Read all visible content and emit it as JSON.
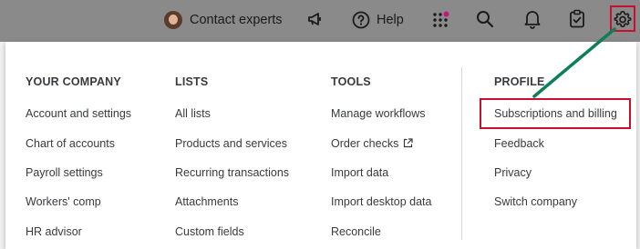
{
  "topbar": {
    "contact_label": "Contact experts",
    "help_label": "Help",
    "icons": [
      "avatar",
      "megaphone-icon",
      "help-circle-icon",
      "apps-grid-icon",
      "search-icon",
      "bell-icon",
      "clipboard-icon",
      "gear-icon"
    ],
    "apps_badge_color": "#c9137e"
  },
  "menu": {
    "columns": [
      {
        "heading": "YOUR COMPANY",
        "items": [
          "Account and settings",
          "Chart of accounts",
          "Payroll settings",
          "Workers' comp",
          "HR advisor"
        ]
      },
      {
        "heading": "LISTS",
        "items": [
          "All lists",
          "Products and services",
          "Recurring transactions",
          "Attachments",
          "Custom fields"
        ]
      },
      {
        "heading": "TOOLS",
        "items": [
          "Manage workflows",
          "Order checks",
          "Import data",
          "Import desktop data",
          "Reconcile"
        ]
      },
      {
        "heading": "PROFILE",
        "items": [
          "Subscriptions and billing",
          "Feedback",
          "Privacy",
          "Switch company"
        ]
      }
    ]
  },
  "annotation": {
    "highlight_color": "#c8102e",
    "arrow_color": "#0e7f5a"
  }
}
